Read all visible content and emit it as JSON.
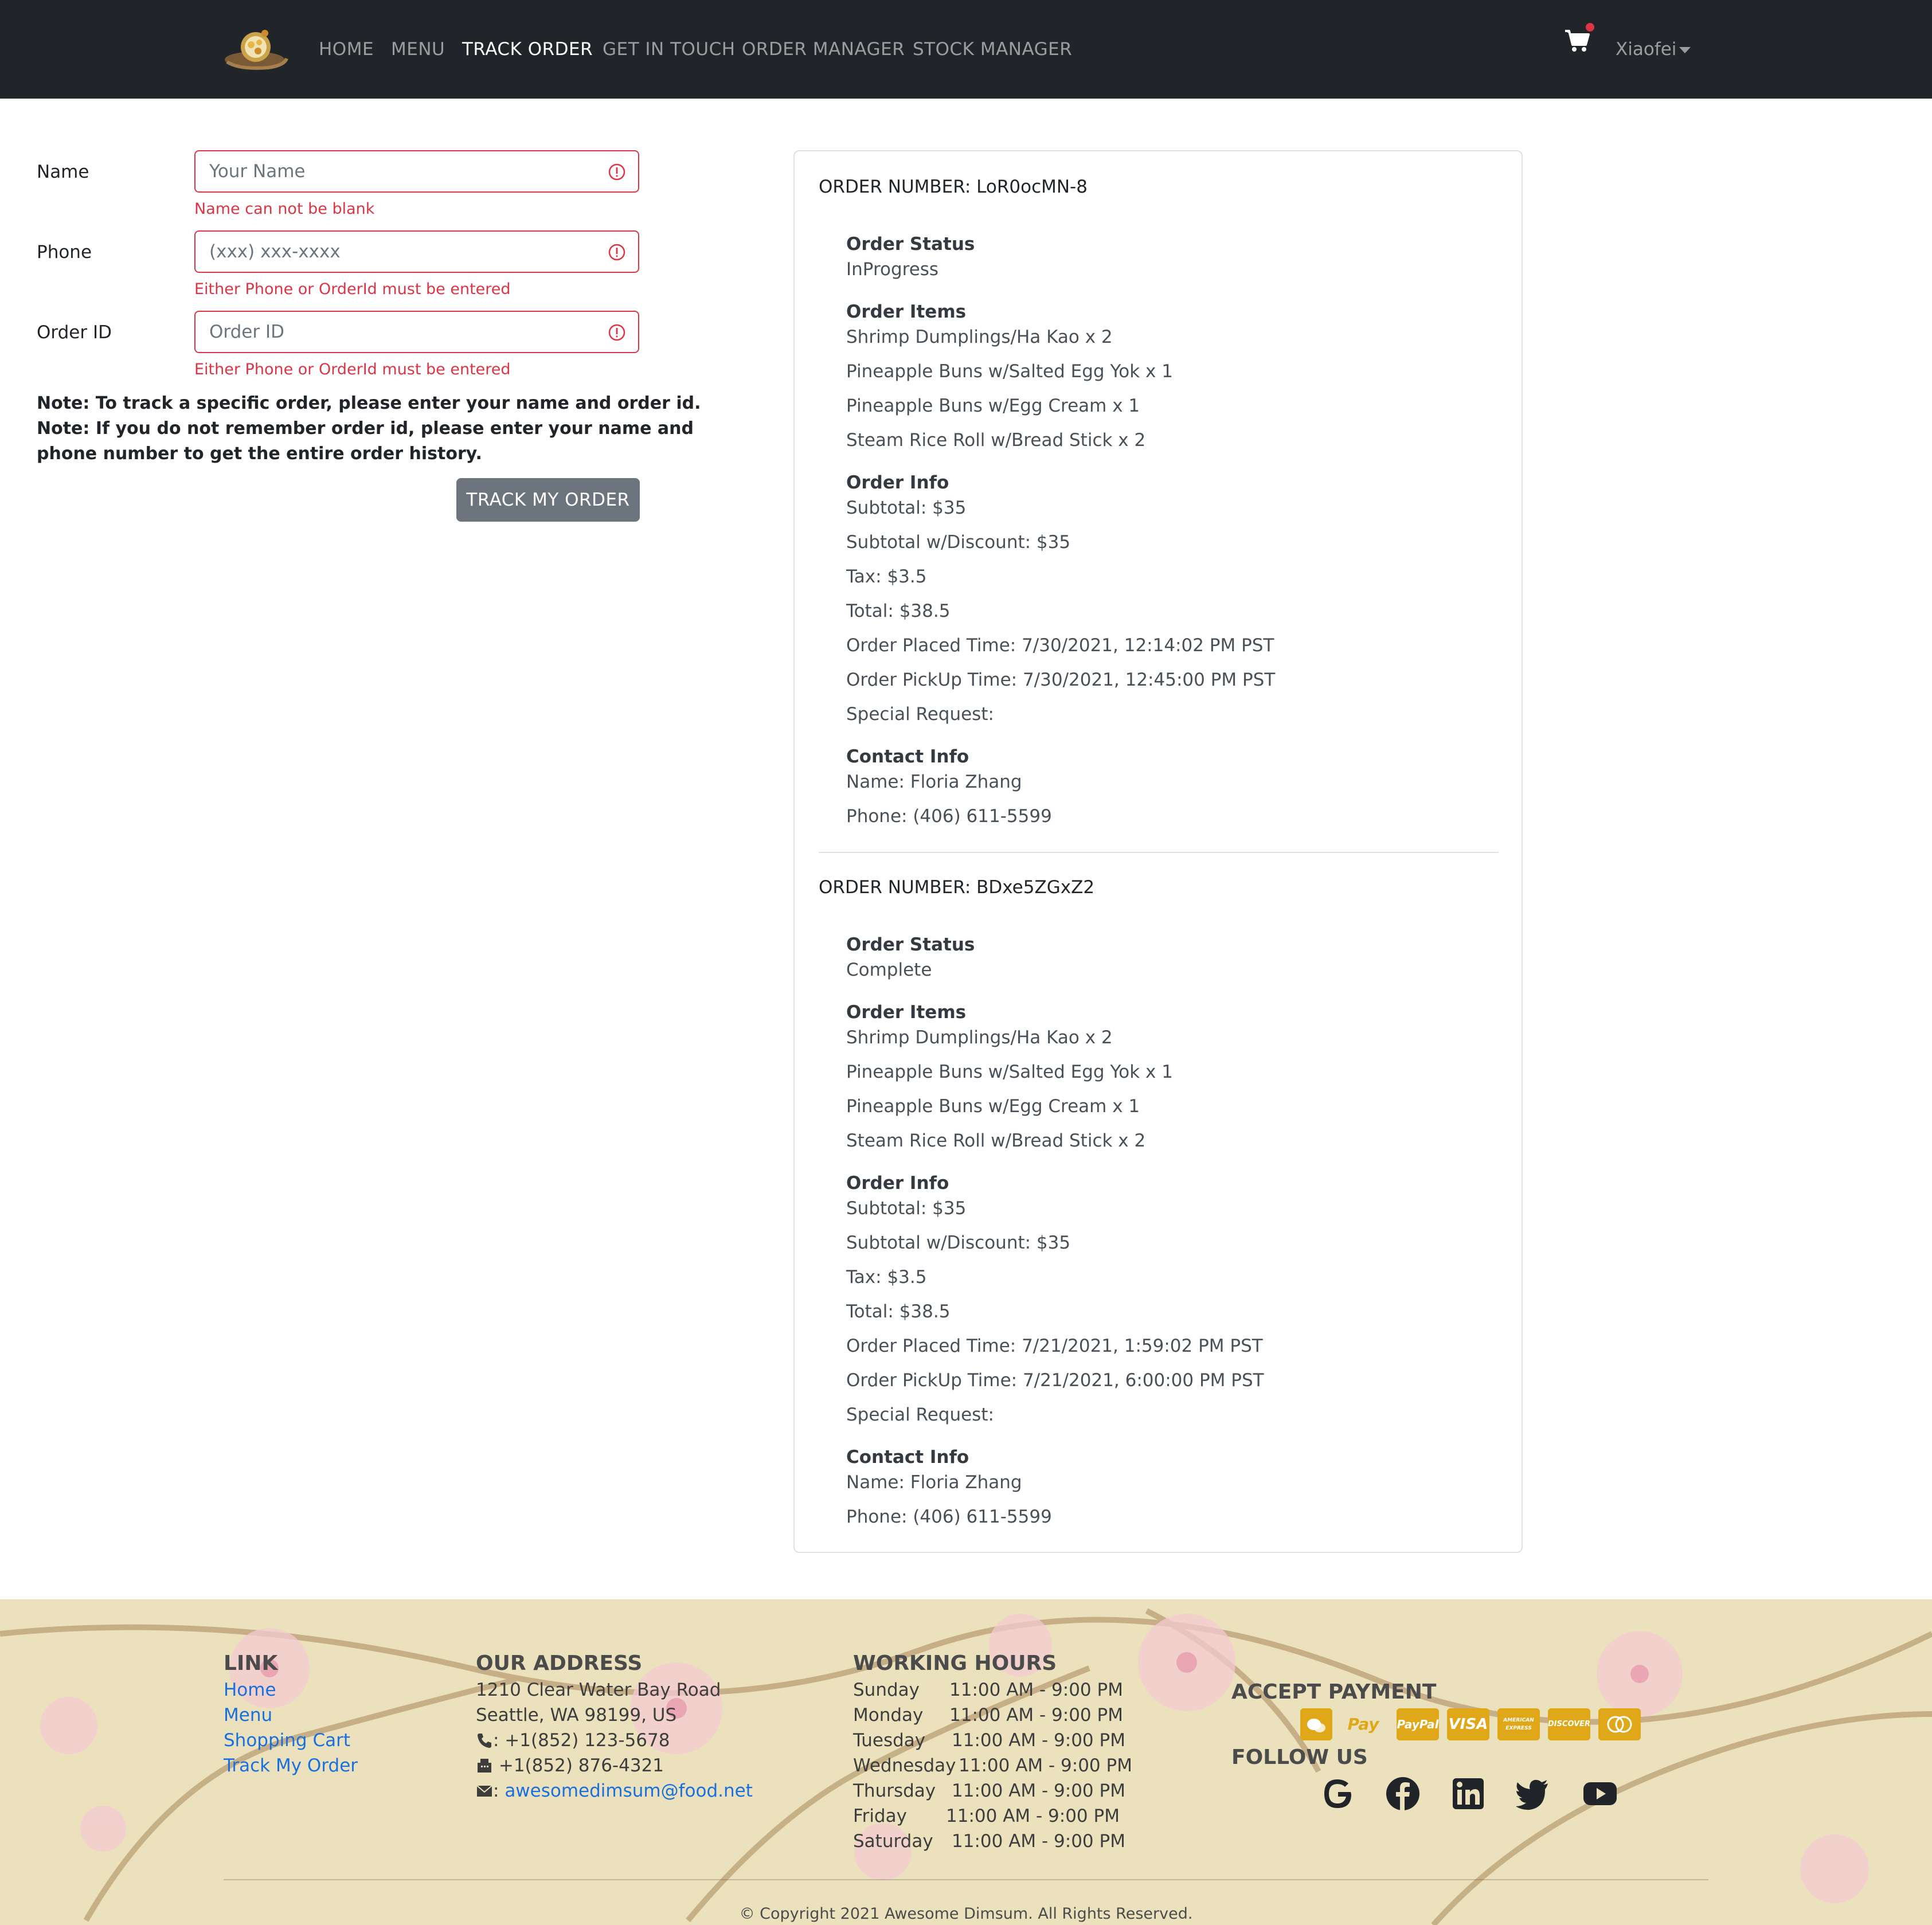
{
  "navbar": {
    "links": [
      "HOME",
      "MENU",
      "TRACK ORDER",
      "GET IN TOUCH",
      "ORDER MANAGER",
      "STOCK MANAGER"
    ],
    "active": "TRACK ORDER",
    "user": "Xiaofei",
    "icons": {
      "logo": "dimsum-logo",
      "cart": "cart-icon",
      "user_menu": "caret-down-icon"
    }
  },
  "form": {
    "name": {
      "label": "Name",
      "placeholder": "Your Name",
      "value": "",
      "error": "Name can not be blank"
    },
    "phone": {
      "label": "Phone",
      "placeholder": "(xxx) xxx-xxxx",
      "value": "",
      "error": "Either Phone or OrderId must be entered"
    },
    "order_id": {
      "label": "Order ID",
      "placeholder": "Order ID",
      "value": "",
      "error": "Either Phone or OrderId must be entered"
    },
    "notes": [
      "Note: To track a specific order, please enter your name and order id.",
      "Note: If you do not remember order id, please enter your name and",
      "phone number to get the entire order history."
    ],
    "button": "TRACK MY ORDER"
  },
  "orders": [
    {
      "number": "ORDER NUMBER: LoR0ocMN-8",
      "status_label": "Order Status",
      "status": "InProgress",
      "items_label": "Order Items",
      "items": [
        "Shrimp Dumplings/Ha Kao x 2",
        "Pineapple Buns w/Salted Egg Yok x 1",
        "Pineapple Buns w/Egg Cream x 1",
        "Steam Rice Roll w/Bread Stick x 2"
      ],
      "info_label": "Order Info",
      "info": [
        "Subtotal: $35",
        "Subtotal w/Discount: $35",
        "Tax: $3.5",
        "Total: $38.5",
        "Order Placed Time: 7/30/2021, 12:14:02 PM PST",
        "Order PickUp Time: 7/30/2021, 12:45:00 PM PST",
        "Special Request:"
      ],
      "contact_label": "Contact Info",
      "contact": [
        "Name: Floria Zhang",
        "Phone: (406) 611-5599"
      ]
    },
    {
      "number": "ORDER NUMBER: BDxe5ZGxZ2",
      "status_label": "Order Status",
      "status": "Complete",
      "items_label": "Order Items",
      "items": [
        "Shrimp Dumplings/Ha Kao x 2",
        "Pineapple Buns w/Salted Egg Yok x 1",
        "Pineapple Buns w/Egg Cream x 1",
        "Steam Rice Roll w/Bread Stick x 2"
      ],
      "info_label": "Order Info",
      "info": [
        "Subtotal: $35",
        "Subtotal w/Discount: $35",
        "Tax: $3.5",
        "Total: $38.5",
        "Order Placed Time: 7/21/2021, 1:59:02 PM PST",
        "Order PickUp Time: 7/21/2021, 6:00:00 PM PST",
        "Special Request:"
      ],
      "contact_label": "Contact Info",
      "contact": [
        "Name: Floria Zhang",
        "Phone: (406) 611-5599"
      ]
    }
  ],
  "footer": {
    "link_heading": "LINK",
    "links": [
      "Home",
      "Menu",
      "Shopping Cart",
      "Track My Order"
    ],
    "address_heading": "OUR ADDRESS",
    "address": [
      "1210 Clear Water Bay Road",
      "Seattle, WA 98199, US"
    ],
    "phone": ": +1(852) 123-5678",
    "fax": " +1(852) 876-4321",
    "email_prefix": ": ",
    "email": "awesomedimsum@food.net",
    "hours_heading": "WORKING HOURS",
    "hours": [
      {
        "day": "Sunday",
        "time": "11:00 AM - 9:00 PM"
      },
      {
        "day": "Monday",
        "time": "11:00 AM - 9:00 PM"
      },
      {
        "day": "Tuesday",
        "time": "11:00 AM - 9:00 PM"
      },
      {
        "day": "Wednesday",
        "time": "11:00 AM - 9:00 PM"
      },
      {
        "day": "Thursday",
        "time": "11:00 AM - 9:00 PM"
      },
      {
        "day": "Friday",
        "time": "11:00 AM - 9:00 PM"
      },
      {
        "day": "Saturday",
        "time": "11:00 AM - 9:00 PM"
      }
    ],
    "payment_heading": "ACCEPT PAYMENT",
    "payment_methods": [
      "Pay",
      "PayPal",
      "VISA",
      "AMERICAN EXPRESS",
      "DISCOVER",
      "mastercard"
    ],
    "payment_icon_names": [
      "wechat-pay-icon",
      "apple-pay-icon",
      "paypal-icon",
      "visa-icon",
      "amex-icon",
      "discover-icon",
      "mastercard-icon"
    ],
    "follow_heading": "FOLLOW US",
    "social_icons": [
      "google-icon",
      "facebook-icon",
      "linkedin-icon",
      "twitter-icon",
      "youtube-icon"
    ],
    "copyright": "© Copyright 2021 Awesome Dimsum. All Rights Reserved."
  },
  "colors": {
    "navbar_bg": "#212529",
    "error": "#dc3545",
    "button_bg": "#6c757d",
    "link": "#1a6fe0",
    "payment_badge": "#e0a818",
    "footer_bg": "#ebe2bd"
  }
}
